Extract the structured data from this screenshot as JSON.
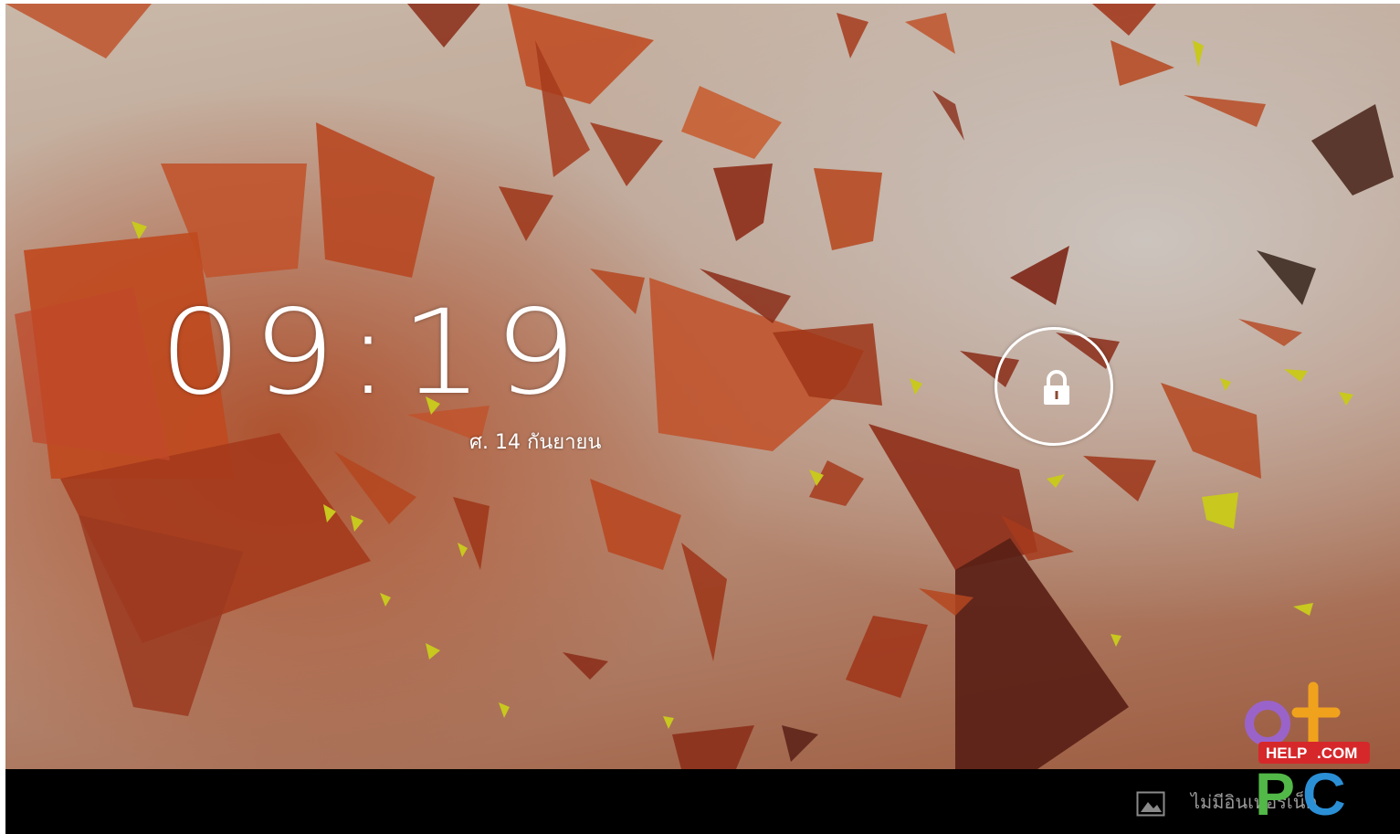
{
  "lockscreen": {
    "time": "09:19",
    "date": "ศ. 14 กันยายน",
    "lock_icon": "lock-icon"
  },
  "navbar": {
    "status_icon": "image-icon",
    "status_text": "ไม่มีอินเทอร์เน็ต"
  },
  "watermark": {
    "text_top": "HELP",
    "text_com": ".COM",
    "text_pc": "PC"
  },
  "colors": {
    "clock_text": "#ffffff",
    "navbar_bg": "#000000",
    "status_text": "#9a9a9a",
    "shard_primary": "#b5461f",
    "shard_dark": "#5a2016",
    "shard_accent": "#c8c81e"
  }
}
